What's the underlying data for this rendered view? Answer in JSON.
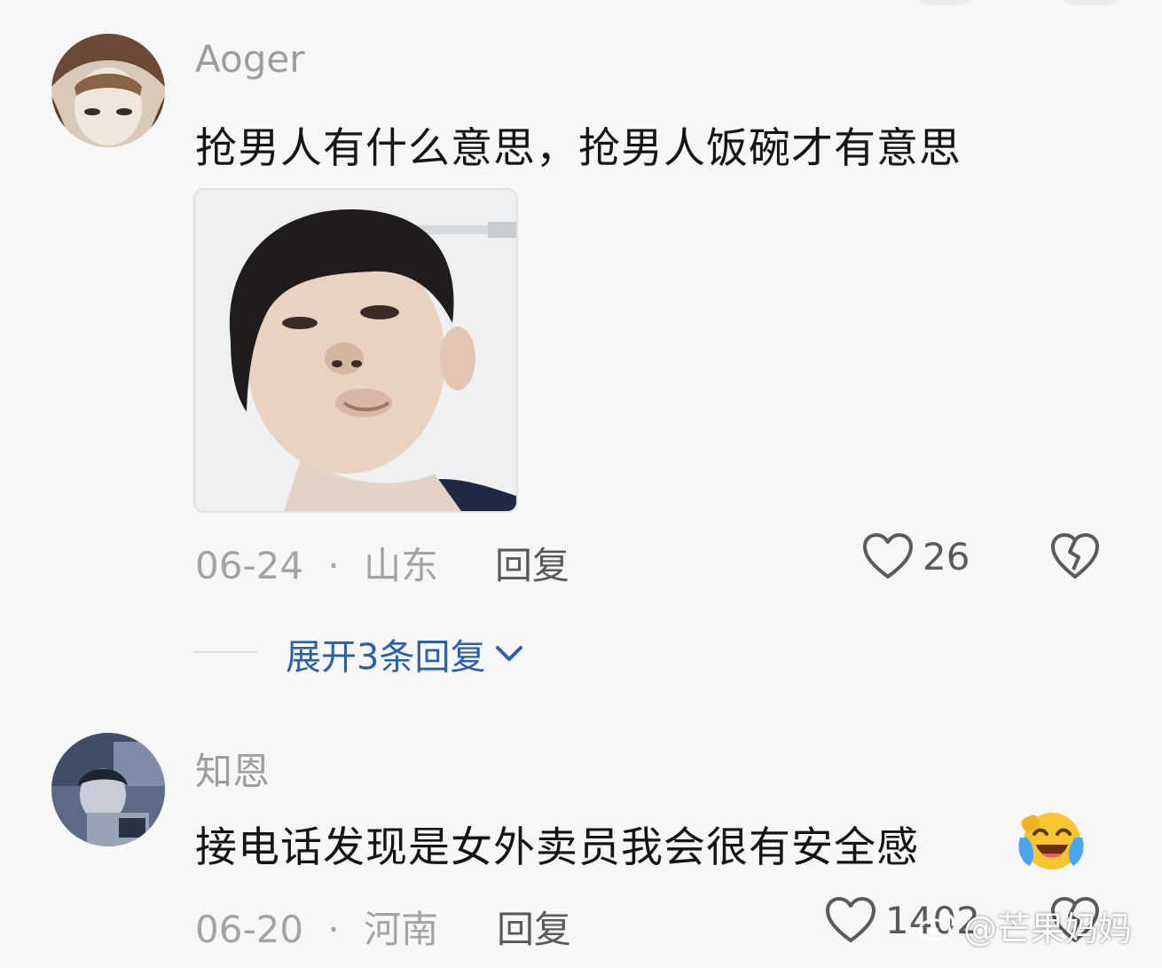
{
  "comments": [
    {
      "username": "Aoger",
      "text": "抢男人有什么意思，抢男人饭碗才有意思",
      "date": "06-24",
      "location": "山东",
      "reply_label": "回复",
      "likes": "26",
      "expand_label": "展开3条回复"
    },
    {
      "username": "知恩",
      "text": "接电话发现是女外卖员我会很有安全感",
      "date": "06-20",
      "location": "河南",
      "reply_label": "回复",
      "likes": "1402"
    }
  ],
  "meta_separator": "·",
  "watermark": "@芒果妈妈",
  "icons": {
    "like": "heart-outline-icon",
    "dislike": "broken-heart-icon",
    "expand": "chevron-down-icon",
    "emoji": "laughing-crying-emoji"
  },
  "colors": {
    "background": "#f7f7f7",
    "username": "#9d9d9d",
    "link": "#2b5fa6",
    "meta": "#a3a3a3"
  }
}
